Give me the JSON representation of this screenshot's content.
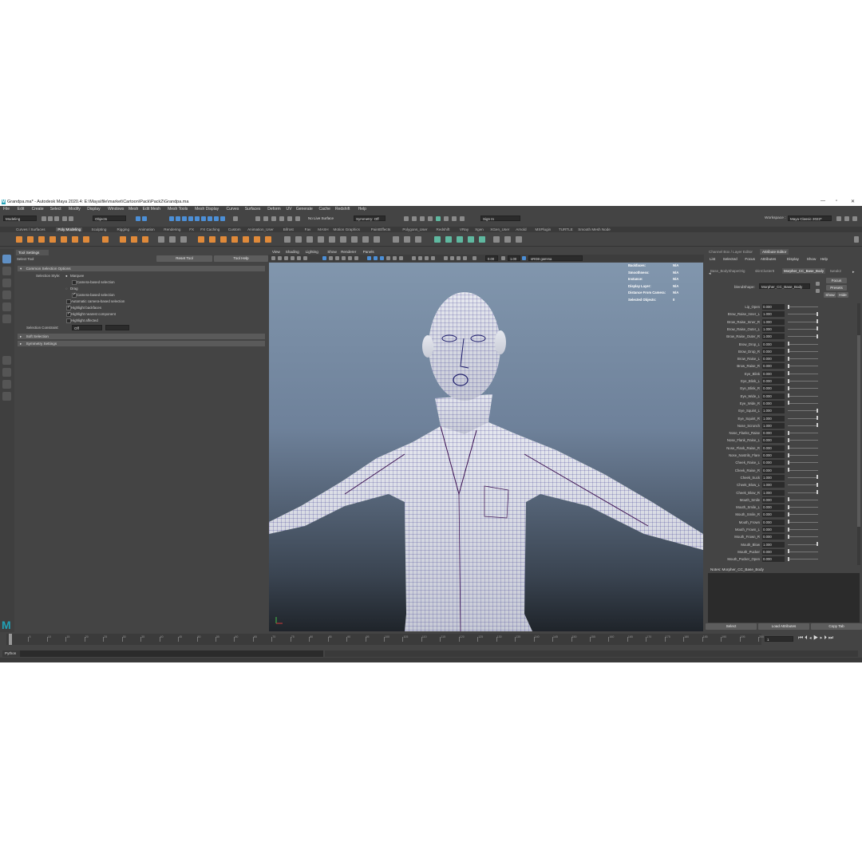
{
  "window": {
    "title": "Grandpa.ma* - Autodesk Maya 2020.4: E:\\Maya\\file\\market\\Cartoon\\Pack\\Pack2\\Grandpa.ma",
    "logo": "M"
  },
  "menu": [
    "File",
    "Edit",
    "Create",
    "Select",
    "Modify",
    "Display",
    "Windows",
    "Mesh",
    "Edit Mesh",
    "Mesh Tools",
    "Mesh Display",
    "Curves",
    "Surfaces",
    "Deform",
    "UV",
    "Generate",
    "Cache",
    "Redshift",
    "Help"
  ],
  "status": {
    "mode": "Modeling",
    "selection_mode": "Objects",
    "live_surface": "No Live Surface",
    "symmetry": "Symmetry: Off",
    "sign_in": "Sign In",
    "workspace_label": "Workspace :",
    "workspace": "Maya Classic 2022*"
  },
  "shelf_tabs": [
    "Curves / Surfaces",
    "Poly Modeling",
    "Sculpting",
    "Rigging",
    "Animation",
    "Rendering",
    "FX",
    "FX Caching",
    "Custom",
    "Animation_User",
    "Bifrost",
    "Fav",
    "MASH",
    "Motion Graphics",
    "PaintEffects",
    "Polygons_User",
    "Redshift",
    "VRay",
    "Xgen",
    "XGen_User",
    "Arnold",
    "MSPlugin",
    "TURTLE",
    "Smooth Mesh Node"
  ],
  "shelf_active": "Poly Modeling",
  "tool_settings": {
    "tab": "Tool Settings",
    "tool": "Select Tool",
    "reset": "Reset Tool",
    "help": "Tool Help",
    "section_common": "Common Selection Options",
    "selection_style_label": "Selection Style:",
    "marquee": "Marquee",
    "camera_based": "Camera-based selection",
    "drag": "Drag",
    "camera_based2": "Camera-based selection",
    "auto_camera": "Automatic camera-based selection",
    "highlight_backfaces": "Highlight backfaces",
    "highlight_nearest": "Highlight nearest component",
    "highlight_affected": "Highlight affected",
    "constraint_label": "Selection Constraint:",
    "constraint_value": "Off",
    "soft_selection": "Soft Selection",
    "symmetry_settings": "Symmetry Settings"
  },
  "viewport": {
    "menu": [
      "View",
      "Shading",
      "Lighting",
      "Show",
      "Renderer",
      "Panels"
    ],
    "exposure": "0.00",
    "gamma": "1.00",
    "colorspace": "sRGB gamma",
    "hud": [
      {
        "label": "Backfaces:",
        "value": "N/A"
      },
      {
        "label": "Smoothness:",
        "value": "N/A"
      },
      {
        "label": "Instance:",
        "value": "N/A"
      },
      {
        "label": "Display Layer:",
        "value": "N/A"
      },
      {
        "label": "Distance From Camera:",
        "value": "N/A"
      },
      {
        "label": "Selected Objects:",
        "value": "0"
      }
    ]
  },
  "attribute_editor": {
    "tabs": [
      "Channel Box / Layer Editor",
      "Attribute Editor"
    ],
    "menu": [
      "List",
      "Selected",
      "Focus",
      "Attributes",
      "Display",
      "Show",
      "Help"
    ],
    "node_tabs": [
      "Base_BodyShapeOrig",
      "skinCluster8",
      "Morpher_CC_Base_Body",
      "tweak2"
    ],
    "blendshape_label": "blendShape:",
    "blendshape_value": "Morpher_CC_Base_Body",
    "focus": "Focus",
    "presets": "Presets",
    "show": "Show",
    "hide": "Hide",
    "attrs": [
      {
        "name": "Lip_Open",
        "value": "0.000",
        "fill": 0.0
      },
      {
        "name": "Brow_Raise_Inner_L",
        "value": "1.000",
        "fill": 1.0
      },
      {
        "name": "Brow_Raise_Inner_R",
        "value": "1.000",
        "fill": 1.0
      },
      {
        "name": "Brow_Raise_Outer_L",
        "value": "1.000",
        "fill": 1.0
      },
      {
        "name": "Brow_Raise_Outer_R",
        "value": "1.000",
        "fill": 1.0
      },
      {
        "name": "Brow_Drop_L",
        "value": "0.000",
        "fill": 0.0
      },
      {
        "name": "Brow_Drop_R",
        "value": "0.000",
        "fill": 0.0
      },
      {
        "name": "Brow_Raise_L",
        "value": "0.000",
        "fill": 0.0
      },
      {
        "name": "Brow_Raise_R",
        "value": "0.000",
        "fill": 0.0
      },
      {
        "name": "Eye_Blink",
        "value": "0.000",
        "fill": 0.0
      },
      {
        "name": "Eye_Blink_L",
        "value": "0.000",
        "fill": 0.0
      },
      {
        "name": "Eye_Blink_R",
        "value": "0.000",
        "fill": 0.0
      },
      {
        "name": "Eye_Wide_L",
        "value": "0.000",
        "fill": 0.0
      },
      {
        "name": "Eye_Wide_R",
        "value": "0.000",
        "fill": 0.0
      },
      {
        "name": "Eye_Squint_L",
        "value": "1.000",
        "fill": 1.0
      },
      {
        "name": "Eye_Squint_R",
        "value": "1.000",
        "fill": 1.0
      },
      {
        "name": "Nose_Scrunch",
        "value": "1.000",
        "fill": 1.0
      },
      {
        "name": "Nose_Flanks_Raise",
        "value": "0.000",
        "fill": 0.0
      },
      {
        "name": "Nose_Flank_Raise_L",
        "value": "0.000",
        "fill": 0.0
      },
      {
        "name": "Nose_Flank_Raise_R",
        "value": "0.000",
        "fill": 0.0
      },
      {
        "name": "Nose_Nostrils_Flare",
        "value": "0.000",
        "fill": 0.0
      },
      {
        "name": "Cheek_Raise_L",
        "value": "0.000",
        "fill": 0.0
      },
      {
        "name": "Cheek_Raise_R",
        "value": "0.000",
        "fill": 0.0
      },
      {
        "name": "Cheek_Suck",
        "value": "1.000",
        "fill": 1.0
      },
      {
        "name": "Cheek_Blow_L",
        "value": "1.000",
        "fill": 1.0
      },
      {
        "name": "Cheek_Blow_R",
        "value": "1.000",
        "fill": 1.0
      },
      {
        "name": "Mouth_Smile",
        "value": "0.000",
        "fill": 0.0
      },
      {
        "name": "Mouth_Smile_L",
        "value": "0.000",
        "fill": 0.0
      },
      {
        "name": "Mouth_Smile_R",
        "value": "0.000",
        "fill": 0.0
      },
      {
        "name": "Mouth_Frown",
        "value": "0.000",
        "fill": 0.0
      },
      {
        "name": "Mouth_Frown_L",
        "value": "0.000",
        "fill": 0.0
      },
      {
        "name": "Mouth_Frown_R",
        "value": "0.000",
        "fill": 0.0
      },
      {
        "name": "Mouth_Blow",
        "value": "1.000",
        "fill": 1.0
      },
      {
        "name": "Mouth_Pucker",
        "value": "0.000",
        "fill": 0.0
      },
      {
        "name": "Mouth_Pucker_Open",
        "value": "0.000",
        "fill": 0.0
      }
    ],
    "notes": "Notes:  Morpher_CC_Base_Body",
    "buttons": [
      "Select",
      "Load Attributes",
      "Copy Tab"
    ]
  },
  "timeline": {
    "current_frame": "1",
    "ticks": [
      "1",
      "5",
      "10",
      "15",
      "20",
      "25",
      "30",
      "35",
      "40",
      "45",
      "50",
      "55",
      "60",
      "65",
      "70",
      "75",
      "80",
      "85",
      "90",
      "95",
      "100",
      "105",
      "110",
      "115",
      "120",
      "125",
      "130",
      "135",
      "140",
      "145",
      "150",
      "155",
      "160",
      "165",
      "170",
      "175",
      "180",
      "185",
      "190",
      "195",
      "200"
    ]
  },
  "cmdline": {
    "lang": "Python"
  }
}
